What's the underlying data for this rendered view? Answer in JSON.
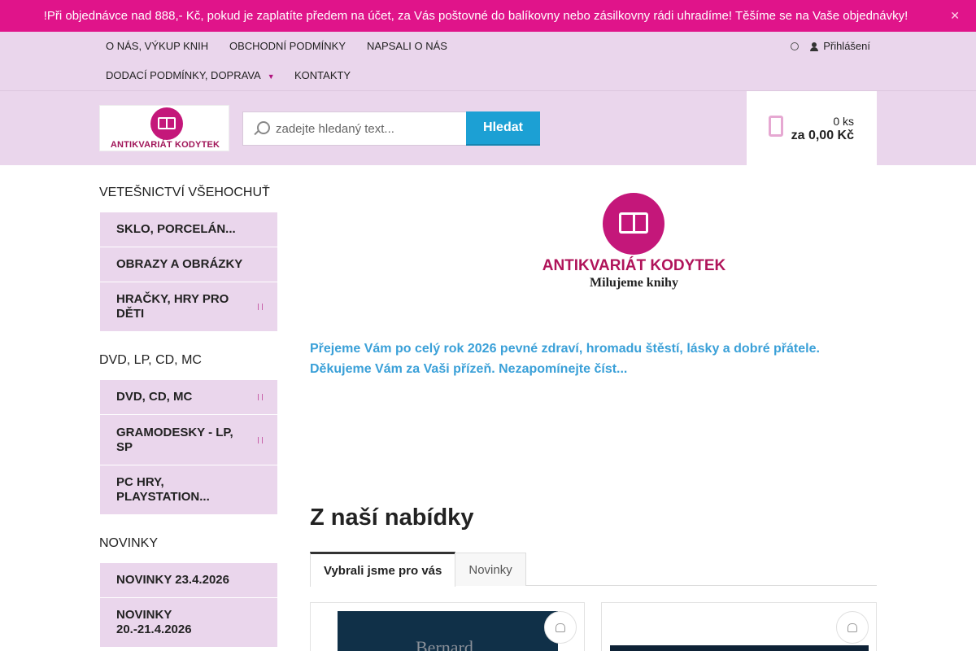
{
  "notice": {
    "text": "!Při objednávce nad 888,- Kč, pokud je zaplatíte předem na účet, za Vás poštovné do balíkovny nebo zásilkovny rádi uhradíme! Těšíme se na Vaše objednávky!",
    "close_icon": "close-icon",
    "color": "#e0148a"
  },
  "topnav": {
    "items": [
      {
        "label": "O nás, výkup knih"
      },
      {
        "label": "Obchodní podmínky"
      },
      {
        "label": "Napsali o nás"
      },
      {
        "label": "Dodací podmínky, doprava"
      },
      {
        "label": "Kontakty"
      }
    ],
    "login_label": "Přihlášení"
  },
  "header": {
    "logo_text": "ANTIKVARIÁT KODYTEK",
    "search": {
      "placeholder": "zadejte hledaný text...",
      "button_label": "Hledat"
    },
    "cart": {
      "count": "0 ks",
      "total": "za 0,00 Kč"
    }
  },
  "sidebar": {
    "sections": [
      {
        "title": "VETEŠNICTVÍ VŠEHOCHUŤ",
        "items": [
          {
            "label": "SKLO, PORCELÁN..."
          },
          {
            "label": "OBRAZY A OBRÁZKY"
          },
          {
            "label": "HRAČKY, HRY PRO DĚTI"
          }
        ]
      },
      {
        "title": "DVD, LP, CD, MC",
        "items": [
          {
            "label": "DVD, CD, MC"
          },
          {
            "label": "GRAMODESKY - LP, SP"
          },
          {
            "label": "PC HRY, PLAYSTATION..."
          }
        ]
      },
      {
        "title": "NOVINKY",
        "items": [
          {
            "label": "NOVINKY 23.4.2026"
          },
          {
            "label": "NOVINKY 20.-21.4.2026"
          }
        ]
      }
    ]
  },
  "main": {
    "hero_logo": {
      "name": "ANTIKVARIÁT KODYTEK",
      "tagline": "Milujeme knihy"
    },
    "greeting": {
      "line1": "Přejeme Vám po celý rok 2026 pevné zdraví, hromadu štěstí, lásky a dobré přátele.",
      "line2": "Děkujeme Vám za Vaši přízeň. Nezapomínejte číst..."
    },
    "offer_title": "Z naší nabídky",
    "tabs": [
      {
        "label": "Vybrali jsme pro vás",
        "active": true
      },
      {
        "label": "Novinky",
        "active": false
      }
    ],
    "products": [
      {
        "cover_text": "Bernard"
      },
      {
        "cover_text": ""
      }
    ]
  },
  "colors": {
    "accent": "#b0147e",
    "nav_bg": "#ead6ec",
    "button_blue": "#1ca0d4",
    "greeting_blue": "#3aa0d8"
  }
}
